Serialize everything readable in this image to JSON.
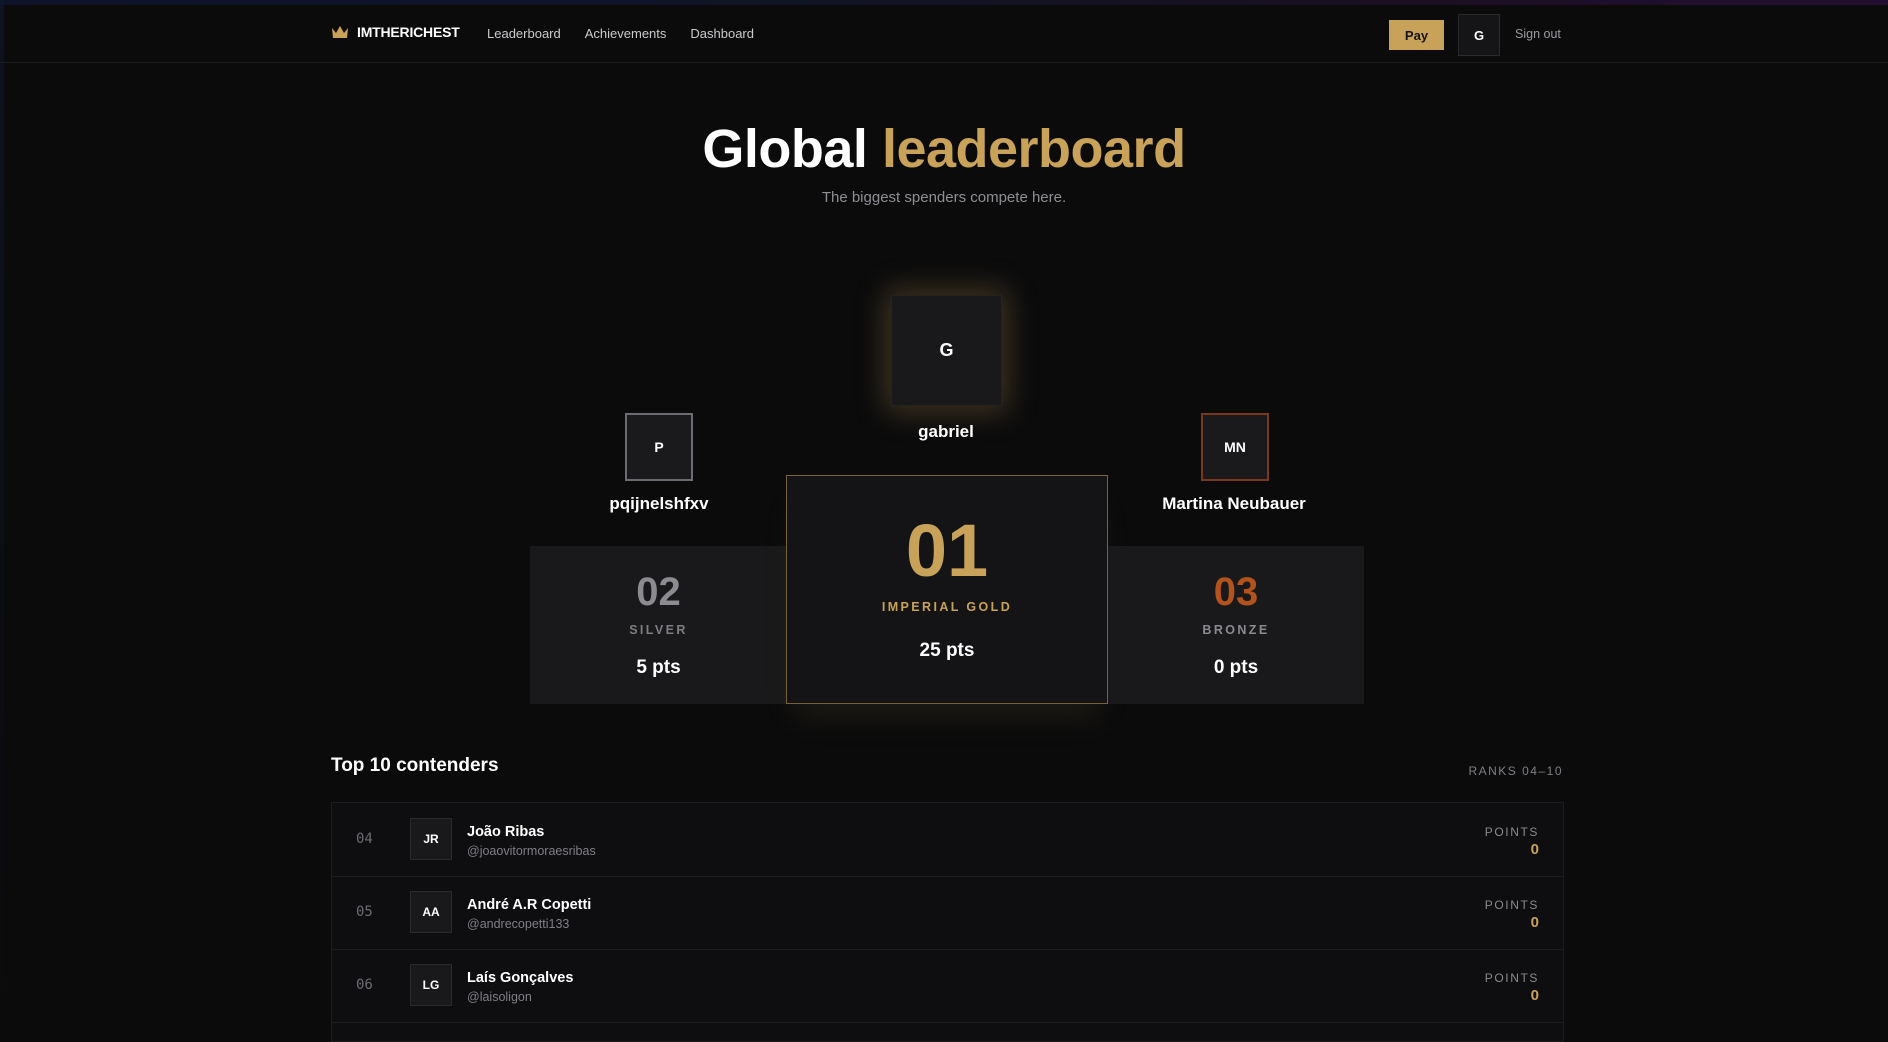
{
  "header": {
    "brand": "IMTHERICHEST",
    "nav": [
      "Leaderboard",
      "Achievements",
      "Dashboard"
    ],
    "pay_label": "Pay",
    "user_initial": "G",
    "signout_label": "Sign out"
  },
  "hero": {
    "title_main": "Global",
    "title_accent": "leaderboard",
    "subtitle": "The biggest spenders compete here."
  },
  "podium": {
    "first": {
      "initials": "G",
      "name": "gabriel",
      "rank": "01",
      "tier": "IMPERIAL GOLD",
      "points": "25 pts"
    },
    "second": {
      "initials": "P",
      "name": "pqijnelshfxv",
      "rank": "02",
      "tier": "SILVER",
      "points": "5 pts"
    },
    "third": {
      "initials": "MN",
      "name": "Martina Neubauer",
      "rank": "03",
      "tier": "BRONZE",
      "points": "0 pts"
    }
  },
  "contenders": {
    "title": "Top 10 contenders",
    "range": "RANKS 04–10",
    "points_label": "POINTS",
    "rows": [
      {
        "rank": "04",
        "initials": "JR",
        "name": "João Ribas",
        "handle": "@joaovitormoraesribas",
        "points": "0"
      },
      {
        "rank": "05",
        "initials": "AA",
        "name": "André A.R Copetti",
        "handle": "@andrecopetti133",
        "points": "0"
      },
      {
        "rank": "06",
        "initials": "LG",
        "name": "Laís Gonçalves",
        "handle": "@laisoligon",
        "points": "0"
      }
    ]
  },
  "colors": {
    "background": "#0b0b0c",
    "gold": "#c9a25a",
    "silver": "#8b8b90",
    "bronze": "#b2521c"
  },
  "icons": {
    "brand": "crown-icon"
  }
}
